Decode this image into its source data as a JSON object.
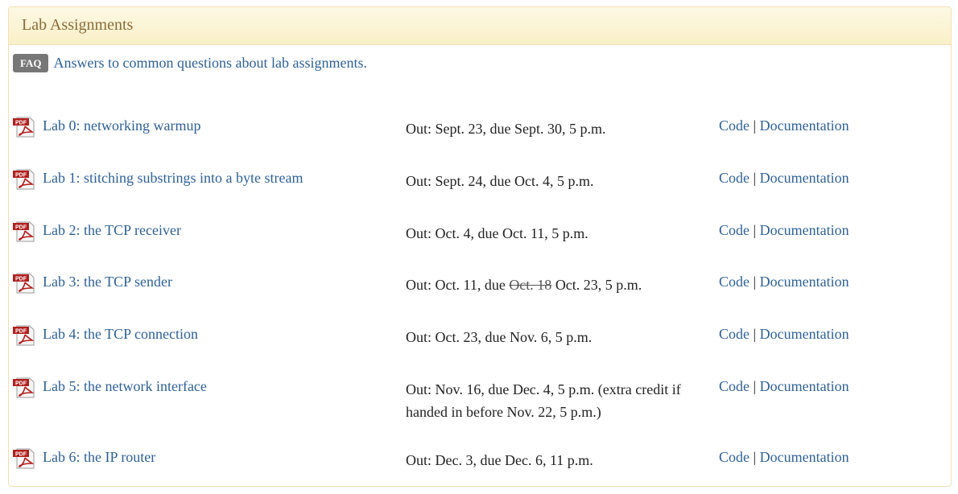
{
  "panel": {
    "title": "Lab Assignments"
  },
  "faq": {
    "badge": "FAQ",
    "link_text": "Answers to common questions about lab assignments."
  },
  "pdf_icon": {
    "icon": "pdf-icon",
    "label": "PDF",
    "color": "#b1201f"
  },
  "links": {
    "code": "Code",
    "separator": "|",
    "docs": "Documentation"
  },
  "labs": [
    {
      "title": "Lab 0: networking warmup",
      "dates_pre": "Out: Sept. 23, due Sept. 30, 5 p.m.",
      "dates_struck": "",
      "dates_post": ""
    },
    {
      "title": "Lab 1: stitching substrings into a byte stream",
      "dates_pre": "Out: Sept. 24, due Oct. 4, 5 p.m.",
      "dates_struck": "",
      "dates_post": ""
    },
    {
      "title": "Lab 2: the TCP receiver",
      "dates_pre": "Out: Oct. 4, due Oct. 11, 5 p.m.",
      "dates_struck": "",
      "dates_post": ""
    },
    {
      "title": "Lab 3: the TCP sender",
      "dates_pre": "Out: Oct. 11, due ",
      "dates_struck": "Oct. 18",
      "dates_post": " Oct. 23, 5 p.m."
    },
    {
      "title": "Lab 4: the TCP connection",
      "dates_pre": "Out: Oct. 23, due Nov. 6, 5 p.m.",
      "dates_struck": "",
      "dates_post": ""
    },
    {
      "title": "Lab 5: the network interface",
      "dates_pre": "Out: Nov. 16, due Dec. 4, 5 p.m. (extra credit if handed in before Nov. 22, 5 p.m.)",
      "dates_struck": "",
      "dates_post": ""
    },
    {
      "title": "Lab 6: the IP router",
      "dates_pre": "Out: Dec. 3, due Dec. 6, 11 p.m.",
      "dates_struck": "",
      "dates_post": ""
    }
  ]
}
